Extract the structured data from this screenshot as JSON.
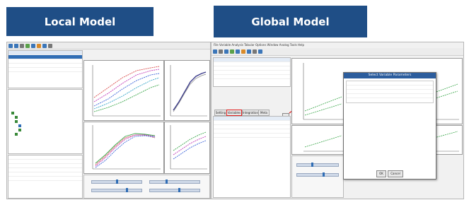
{
  "banners": {
    "local": "Local Model",
    "global": "Global Model"
  },
  "global": {
    "menubar": "File  Variable  Analysis  Tabular  Options  Window  Analog  Tools  Help",
    "tabs": [
      "Setting",
      "Variables",
      "Integration",
      "Meta"
    ],
    "dialog": {
      "title": "Select Variable Parameters",
      "ok_label": "OK",
      "cancel_label": "Cancel"
    }
  },
  "colors": {
    "banner": "#1f4e86",
    "highlight": "#e02020",
    "selection": "#2f6db5"
  }
}
